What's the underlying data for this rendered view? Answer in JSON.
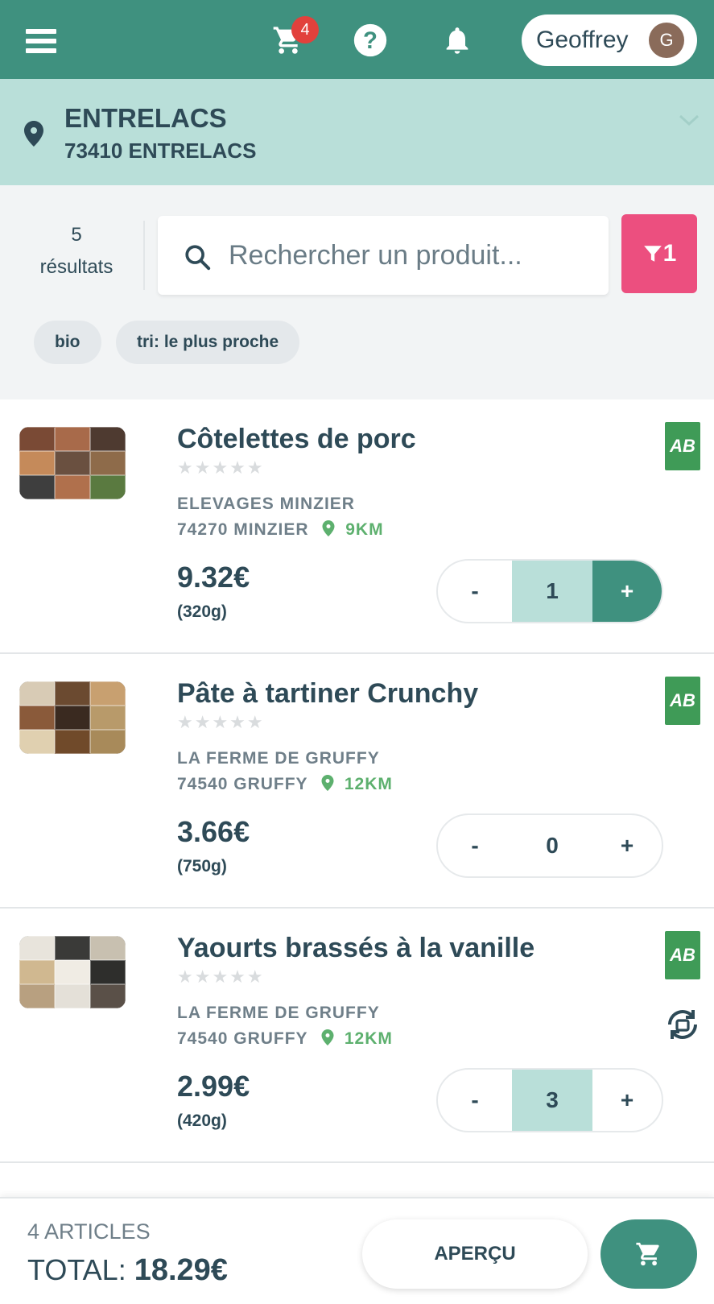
{
  "header": {
    "cart_count": "4",
    "user_name": "Geoffrey",
    "avatar_initial": "G"
  },
  "location": {
    "city": "ENTRELACS",
    "zip_city": "73410 ENTRELACS"
  },
  "search": {
    "results_count": "5",
    "results_label": "résultats",
    "placeholder": "Rechercher un produit...",
    "filter_count": "1"
  },
  "chips": [
    "bio",
    "tri: le plus proche"
  ],
  "products": [
    {
      "name": "Côtelettes de porc",
      "producer": "ELEVAGES MINZIER",
      "city": "74270 MINZIER",
      "distance": "9KM",
      "price": "9.32€",
      "weight": "(320g)",
      "qty": "1",
      "minus": "-",
      "plus": "+",
      "stars": "★★★★★",
      "label": "AB"
    },
    {
      "name": "Pâte à tartiner Crunchy",
      "producer": "LA FERME DE GRUFFY",
      "city": "74540 GRUFFY",
      "distance": "12KM",
      "price": "3.66€",
      "weight": "(750g)",
      "qty": "0",
      "minus": "-",
      "plus": "+",
      "stars": "★★★★★",
      "label": "AB"
    },
    {
      "name": "Yaourts brassés à la vanille",
      "producer": "LA FERME DE GRUFFY",
      "city": "74540 GRUFFY",
      "distance": "12KM",
      "price": "2.99€",
      "weight": "(420g)",
      "qty": "3",
      "minus": "-",
      "plus": "+",
      "stars": "★★★★★",
      "label": "AB"
    }
  ],
  "footer": {
    "articles": "4 ARTICLES",
    "total_label": "TOTAL:",
    "total_value": "18.29€",
    "apercu": "APERÇU"
  },
  "colors": {
    "primary": "#3f917f",
    "light_teal": "#b9dfd9",
    "filter_pink": "#ec4f7f",
    "badge_red": "#e2413c",
    "distance_green": "#5db06e"
  }
}
